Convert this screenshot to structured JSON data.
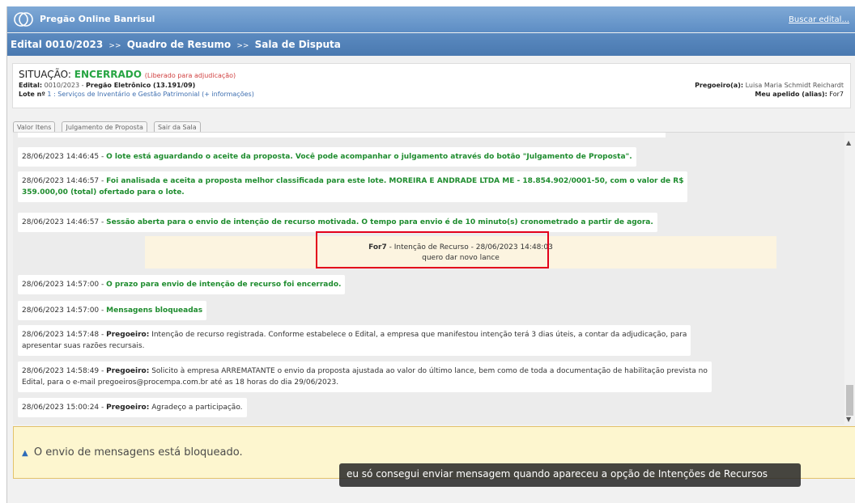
{
  "appbar": {
    "title": "Pregão Online Banrisul",
    "search_link": "Buscar edital..."
  },
  "breadcrumb": {
    "items": [
      "Edital 0010/2023",
      "Quadro de Resumo",
      "Sala de Disputa"
    ],
    "separator": ">>"
  },
  "info": {
    "situacao_label": "SITUAÇÃO:",
    "situacao_value": "ENCERRADO",
    "situacao_note": "(Liberado para adjudicação)",
    "edital_label": "Edital:",
    "edital_value": "0010/2023 -",
    "modalidade": "Pregão Eletrônico (13.191/09)",
    "lote_label": "Lote nº",
    "lote_value": "1 : Serviços de Inventário e Gestão Patrimonial (+ informações)",
    "pregoeiro_label": "Pregoeiro(a):",
    "pregoeiro_value": "Luisa Maria Schmidt Reichardt",
    "apelido_label": "Meu apelido (alias):",
    "apelido_value": "For7"
  },
  "buttons": {
    "valor_itens": "Valor Itens",
    "julgamento": "Julgamento de Proposta",
    "sair": "Sair da Sala"
  },
  "messages": [
    {
      "ts": "28/06/2023 14:46:45 -",
      "text": "O lote está aguardando o aceite da proposta. Você pode acompanhar o julgamento através do botão \"Julgamento de Proposta\"."
    },
    {
      "ts": "28/06/2023 14:46:57 -",
      "text": "Foi analisada e aceita a proposta melhor classificada para este lote. MOREIRA E ANDRADE LTDA ME - 18.854.902/0001-50, com o valor de R$",
      "text2": "359.000,00 (total) ofertado para o lote."
    },
    {
      "ts": "28/06/2023 14:46:57 -",
      "text": "Sessão aberta para o envio de intenção de recurso motivada. O tempo para envio é de 10 minuto(s) cronometrado a partir de agora."
    },
    {
      "ts": "28/06/2023 14:57:00 -",
      "text": "O prazo para envio de intenção de recurso foi encerrado."
    },
    {
      "ts": "28/06/2023 14:57:00 -",
      "text": "Mensagens bloqueadas"
    },
    {
      "ts": "28/06/2023 14:57:48 -",
      "who": "Pregoeiro:",
      "text": "Intenção de recurso registrada. Conforme estabelece o Edital, a empresa que manifestou intenção terá 3 dias úteis, a contar da adjudicação, para",
      "text2": "apresentar suas razões recursais."
    },
    {
      "ts": "28/06/2023 14:58:49 -",
      "who": "Pregoeiro:",
      "text": "Solicito à empresa ARREMATANTE o envio da proposta ajustada ao valor do último lance, bem como de toda a documentação de habilitação prevista no",
      "text2": "Edital, para o e-mail pregoeiros@procempa.com.br até as 18 horas do dia 29/06/2023."
    },
    {
      "ts": "28/06/2023 15:00:24 -",
      "who": "Pregoeiro:",
      "text": "Agradeço a participação."
    }
  ],
  "recurso": {
    "user": "For7",
    "header": "- Intenção de Recurso - 28/06/2023 14:48:03",
    "body": "quero dar novo lance"
  },
  "blocked_notice": "O envio de mensagens está bloqueado.",
  "caption": "eu só consegui enviar mensagem quando apareceu a opção de Intenções de Recursos",
  "colors": {
    "header_blue": "#5d8dc4",
    "system_green": "#1e8c2e",
    "highlight_red": "#e3001b",
    "notice_yellow": "#fdf6cf"
  }
}
